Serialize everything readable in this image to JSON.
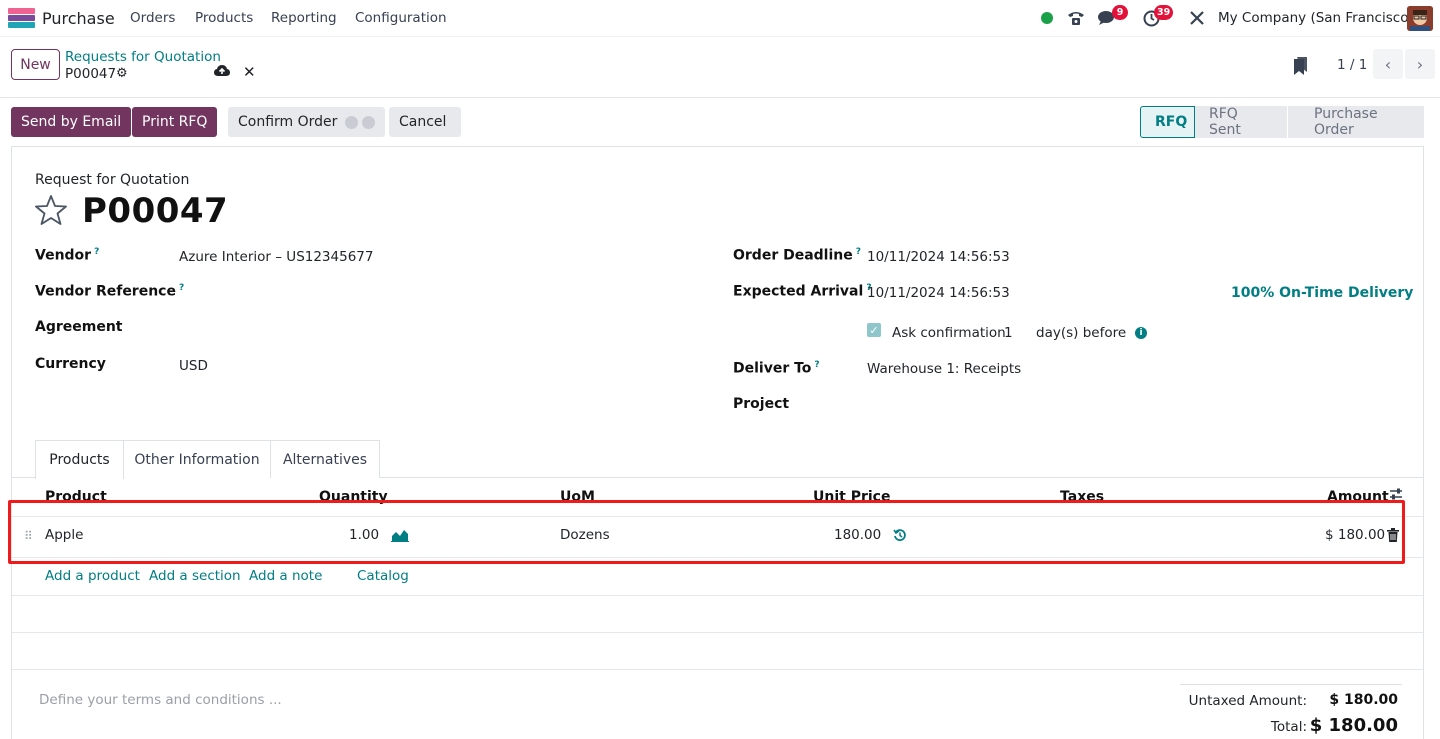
{
  "navbar": {
    "app_name": "Purchase",
    "menu": [
      "Orders",
      "Products",
      "Reporting",
      "Configuration"
    ],
    "chat_badge": "9",
    "activity_badge": "39",
    "company": "My Company (San Francisco)"
  },
  "control_panel": {
    "new_label": "New",
    "breadcrumb_parent": "Requests for Quotation",
    "breadcrumb_current": "P00047",
    "pager": "1 / 1"
  },
  "actions": {
    "send_email": "Send by Email",
    "print_rfq": "Print RFQ",
    "confirm_order": "Confirm Order",
    "cancel": "Cancel"
  },
  "statusbar": [
    "RFQ",
    "RFQ Sent",
    "Purchase Order"
  ],
  "form": {
    "subtitle": "Request for Quotation",
    "title": "P00047",
    "vendor_label": "Vendor",
    "vendor_value": "Azure Interior – US12345677",
    "vendor_ref_label": "Vendor Reference",
    "agreement_label": "Agreement",
    "currency_label": "Currency",
    "currency_value": "USD",
    "deadline_label": "Order Deadline",
    "deadline_value": "10/11/2024 14:56:53",
    "arrival_label": "Expected Arrival",
    "arrival_value": "10/11/2024 14:56:53",
    "ontime": "100% On-Time Delivery",
    "ask_confirmation": "Ask confirmation",
    "ask_days": "1",
    "days_before": "day(s) before",
    "deliver_label": "Deliver To",
    "deliver_value": "Warehouse 1: Receipts",
    "project_label": "Project",
    "help_mark": "?"
  },
  "tabs": [
    "Products",
    "Other Information",
    "Alternatives"
  ],
  "table": {
    "headers": [
      "Product",
      "Quantity",
      "UoM",
      "Unit Price",
      "Taxes",
      "Amount"
    ],
    "row": {
      "product": "Apple",
      "quantity": "1.00",
      "uom": "Dozens",
      "unit_price": "180.00",
      "taxes": "",
      "amount": "$ 180.00"
    },
    "links": [
      "Add a product",
      "Add a section",
      "Add a note",
      "Catalog"
    ]
  },
  "footer": {
    "terms_placeholder": "Define your terms and conditions ...",
    "untaxed_label": "Untaxed Amount:",
    "untaxed_value": "$ 180.00",
    "total_label": "Total:",
    "total_value": "$ 180.00"
  },
  "colors": {
    "brand": "#71355f",
    "accent": "#017e84",
    "highlight": "#ef1b1b",
    "badge": "#e3123a"
  }
}
